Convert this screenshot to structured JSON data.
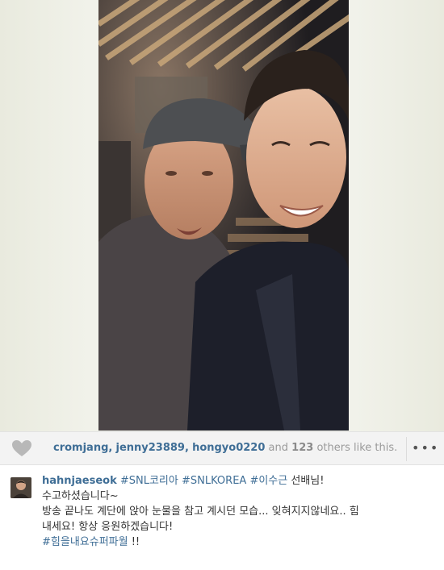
{
  "post": {
    "likes": {
      "users": [
        "cromjang",
        "jenny23889",
        "hongyo0220"
      ],
      "separator": ",",
      "and_text": "and",
      "others_count": "123",
      "suffix": "others like this."
    },
    "more_label": "•••"
  },
  "comment": {
    "author": "hahnjaeseok",
    "hashtags": [
      "#SNL코리아",
      "#SNLKOREA",
      "#이수근"
    ],
    "line1_tail": "선배님!",
    "line2": "수고하셨습니다~",
    "line3": "방송 끝나도 계단에 앉아 눈물을 참고 계시던 모습... 잊혀지지않네요.. 힘",
    "line4": "내세요! 항상 응원하겠습니다!",
    "final_tag": "#힘을내요슈퍼파월",
    "final_tail": "!!"
  },
  "colors": {
    "link_blue": "#3f6e96",
    "like_bar_bg": "#f3f3f3",
    "frame_bg": "#f1f2ea"
  },
  "icons": [
    "heart-icon",
    "more-options-icon"
  ]
}
